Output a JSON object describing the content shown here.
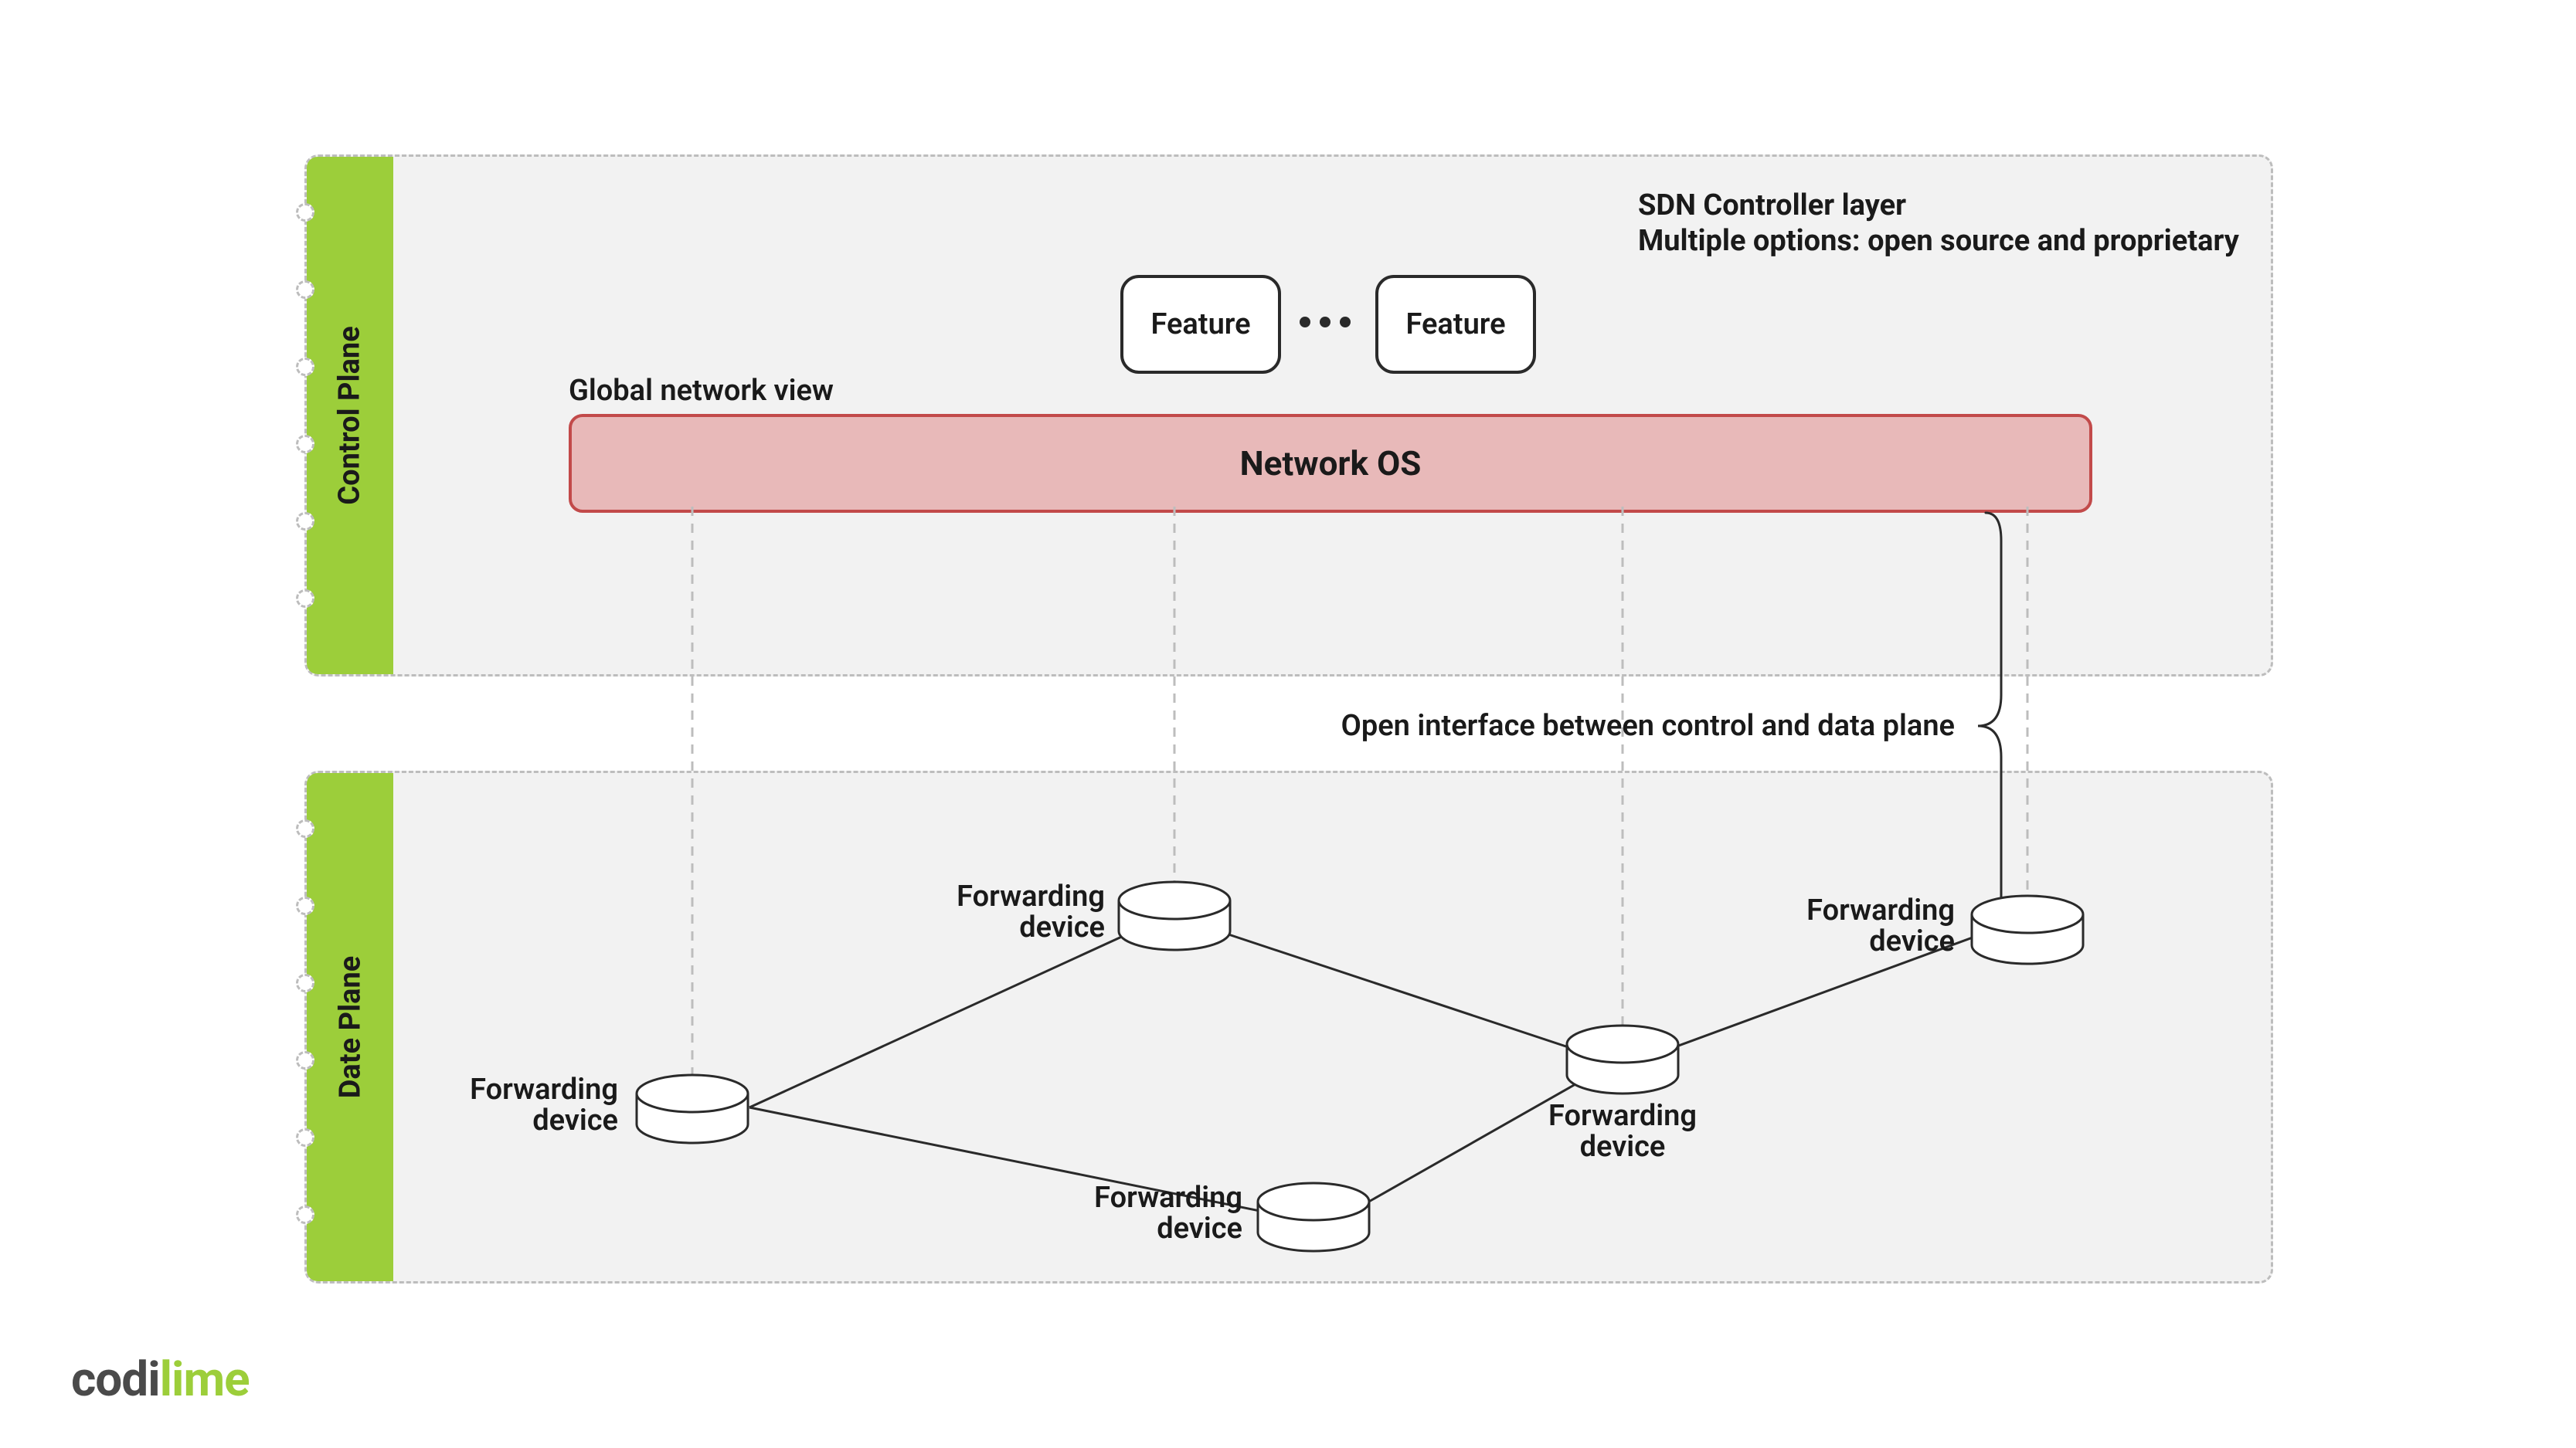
{
  "controlPlane": {
    "sideLabel": "Control Plane",
    "sdnLine1": "SDN Controller layer",
    "sdnLine2": "Multiple options: open source and proprietary",
    "feature1": "Feature",
    "feature2": "Feature",
    "globalView": "Global network view",
    "networkOS": "Network OS"
  },
  "interface": {
    "label": "Open interface between control and data plane"
  },
  "dataPlane": {
    "sideLabel": "Date Plane",
    "device1": "Forwarding\ndevice",
    "device2": "Forwarding\ndevice",
    "device3": "Forwarding\ndevice",
    "device4": "Forwarding\ndevice",
    "device5": "Forwarding\ndevice"
  },
  "logo": {
    "part1": "codi",
    "part2": "lime"
  }
}
